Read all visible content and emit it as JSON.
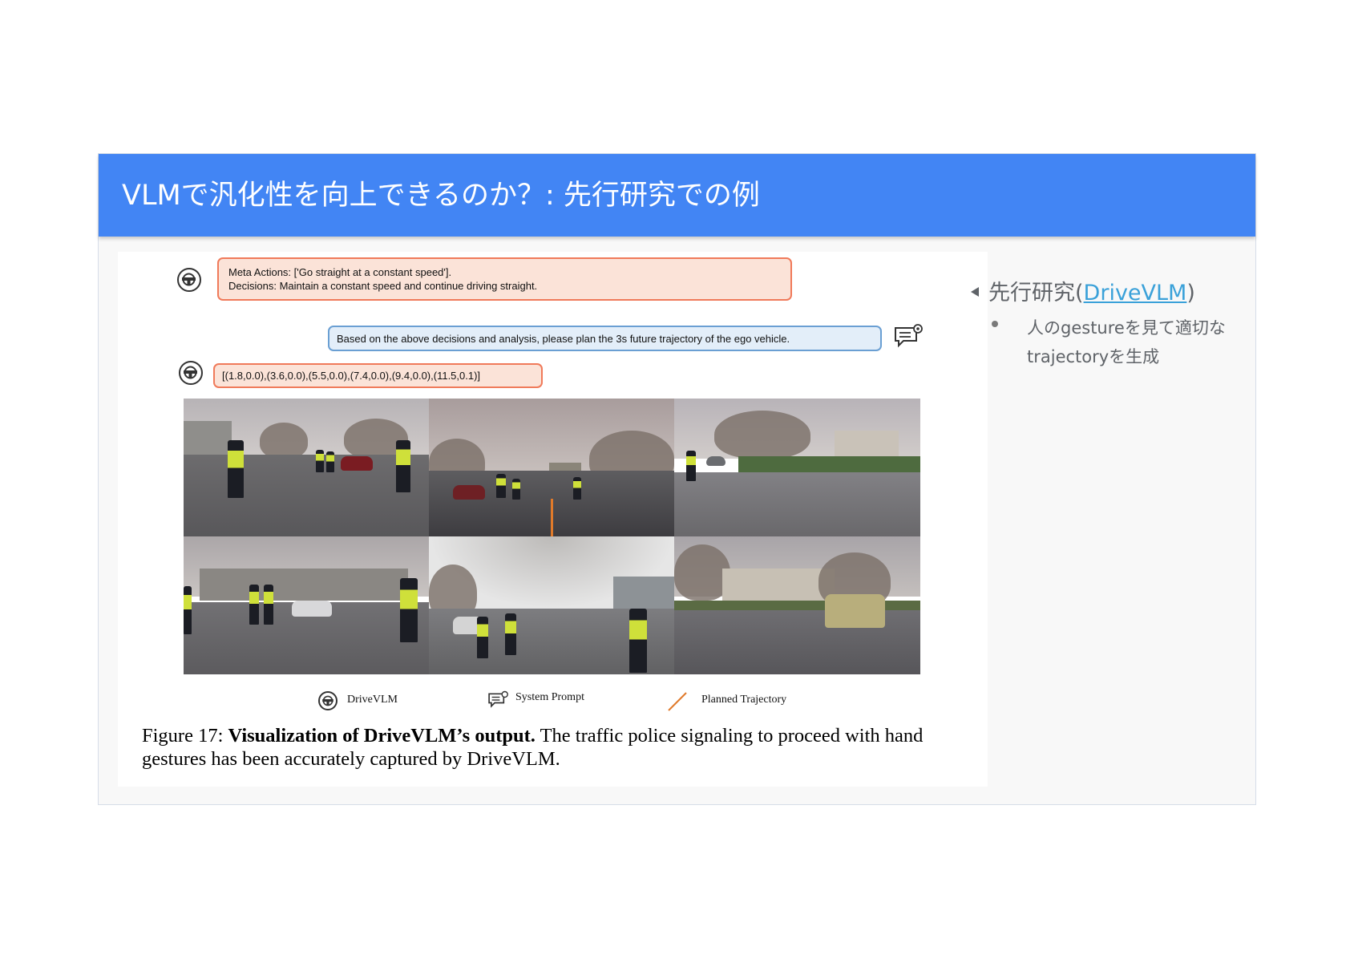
{
  "slide": {
    "title": "VLMで汎化性を向上できるのか？: 先行研究での例",
    "colors": {
      "title_bar": "#4285f4",
      "body_text": "#5f6368",
      "link": "#3aa1d9"
    }
  },
  "figure": {
    "bubble1": {
      "line1": "Meta Actions: ['Go straight at a constant speed'].",
      "line2": "Decisions: Maintain a constant speed and continue driving straight."
    },
    "bubble2": {
      "text": "Based on the above decisions and analysis, please plan the 3s future trajectory of the ego vehicle."
    },
    "bubble3": {
      "text": "[(1.8,0.0),(3.6,0.0),(5.5,0.0),(7.4,0.0),(9.4,0.0),(11.5,0.1)]"
    },
    "legend": {
      "drivevlm": "DriveVLM",
      "system_prompt": "System Prompt",
      "planned_trajectory": "Planned Trajectory"
    },
    "caption": {
      "prefix": "Figure 17: ",
      "bold": "Visualization of DriveVLM’s output.",
      "rest": " The traffic police signaling to proceed with hand gestures has been accurately captured by DriveVLM."
    }
  },
  "sidebar": {
    "heading_prefix": "先行研究(",
    "heading_link": "DriveVLM",
    "heading_suffix": ")",
    "bullet_text": "人のgestureを見て適切なtrajectoryを生成"
  }
}
